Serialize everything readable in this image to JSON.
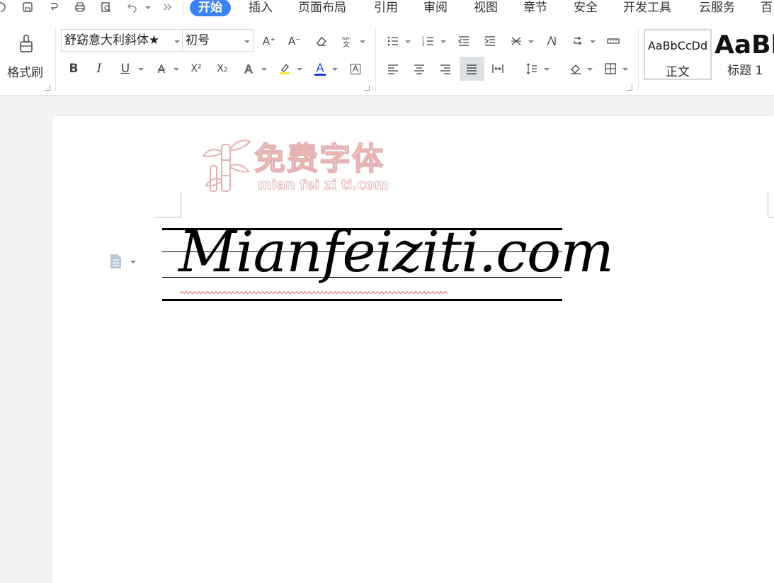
{
  "menu": {
    "tabs": [
      "开始",
      "插入",
      "页面布局",
      "引用",
      "审阅",
      "视图",
      "章节",
      "安全",
      "开发工具",
      "云服务",
      "百"
    ],
    "active_index": 0
  },
  "ribbon": {
    "format_painter_label": "格式刷",
    "font_name": "舒窈意大利斜体★",
    "font_size": "初号",
    "styles": [
      {
        "preview": "AaBbCcDd",
        "label": "正文"
      },
      {
        "preview": "AaBb",
        "label": "标题 1"
      }
    ],
    "glyphs": {
      "bold": "B",
      "italic": "I",
      "underline": "U",
      "strike": "A",
      "superscript": "X²",
      "subscript": "X₂",
      "text_effect": "A",
      "font_color": "A",
      "char_border": "A",
      "grow_font": "A⁺",
      "shrink_font": "A⁻"
    },
    "colors": {
      "highlight": "#f5e63b",
      "font_color": "#1f3fd6",
      "accent": "#3b82f6"
    }
  },
  "document": {
    "watermark_title": "免费字体",
    "watermark_sub": "mian fei zi ti.com",
    "body_text": "Mianfeiziti.com"
  }
}
